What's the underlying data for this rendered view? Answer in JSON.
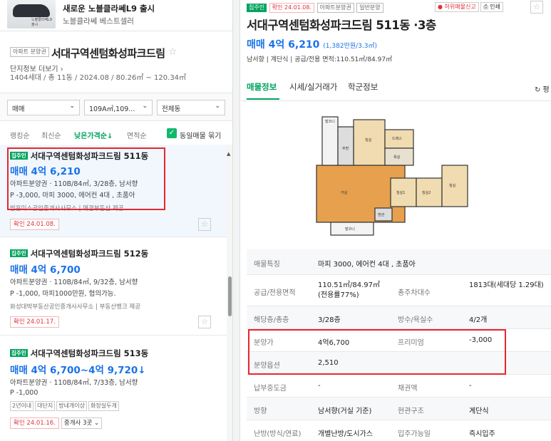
{
  "ad": {
    "title": "새로운 노블클라쎄L9 출시",
    "subtitle": "노블클라쎄 베스트셀러",
    "thumb_caption": "노블클라쎄L9 출시"
  },
  "complex": {
    "tag": "아파트 분양권",
    "name": "서대구역센텀화성파크드림",
    "more": "단지정보 더보기",
    "info": "1404세대 / 총 11동 / 2024.08 / 80.26㎡ ~ 120.34㎡"
  },
  "filters": {
    "trade": "매매",
    "area": "109A㎡,109...",
    "dong": "전체동"
  },
  "sort": {
    "options": [
      "랭킹순",
      "최신순",
      "낮은가격순↓",
      "면적순"
    ],
    "same_listing": "동일매물 묶기"
  },
  "listings": [
    {
      "badge": "집주인",
      "name": "서대구역센텀화성파크드림 511동",
      "price": "매매 4억 6,210",
      "line1": "아파트분양권 · 110B/84㎡, 3/28층, 남서향",
      "line2": "P -3,000, 마피 3000, 에어컨 4대 , 초품아",
      "agent": "방용미소공인중개사사무소 | 매경부동산 제공",
      "confirm": "확인 24.01.08."
    },
    {
      "badge": "집주인",
      "name": "서대구역센텀화성파크드림 512동",
      "price": "매매 4억 6,700",
      "line1": "아파트분양권 · 110B/84㎡, 9/32층, 남서향",
      "line2": "P -1,000, 마피1000만원, 협의가능.",
      "agent": "화성대박부동산공인중개사사무소 | 부동산뱅크 제공",
      "confirm": "확인 24.01.17."
    },
    {
      "badge": "집주인",
      "name": "서대구역센텀화성파크드림 513동",
      "price": "매매 4억 6,700~4억 9,720",
      "price_arrow": "↓",
      "line1": "아파트분양권 · 110B/84㎡, 7/33층, 남서향",
      "line2": "P -1,000",
      "tags": [
        "2년이내",
        "대단지",
        "방네개이상",
        "화장실두개"
      ],
      "confirm": "확인 24.01.16.",
      "agency_chip": "중개사 3곳 ⌄"
    }
  ],
  "detail": {
    "badge": "집주인",
    "confirm": "확인 24.01.08.",
    "tags": [
      "아파트분양권",
      "일반분양"
    ],
    "report": "● 허위매물신고",
    "print": "⎙ 인쇄",
    "title": "서대구역센텀화성파크드림 511동 ·3층",
    "price": "매매 4억 6,210",
    "price_unit": "(1,382만원/3.3㎡)",
    "spec": "남서향  |  계단식  |  공급/전용 면적:110.51㎡/84.97㎡",
    "tabs": [
      "매물정보",
      "시세/실거래가",
      "학군정보"
    ],
    "refresh": "↻ 평",
    "plan_labels": [
      "발코니",
      "침실",
      "드레스",
      "욕실",
      "주방",
      "거실",
      "현관",
      "침실1",
      "침실2",
      "침실",
      "발코니"
    ],
    "table": [
      {
        "k": "매물특징",
        "v": "마피 3000, 에어컨 4대 , 초품아"
      },
      {
        "k": "공급/전용면적",
        "v": "110.51㎡/84.97㎡(전용률77%)",
        "k2": "총주차대수",
        "v2": "1813대(세대당 1.29대)"
      },
      {
        "k": "해당층/총층",
        "v": "3/28층",
        "k2": "방수/욕실수",
        "v2": "4/2개"
      },
      {
        "k": "분양가",
        "v": "4억6,700",
        "k2": "프리미엄",
        "v2": "-3,000"
      },
      {
        "k": "분양옵션",
        "v": "2,510"
      },
      {
        "k": "납부중도금",
        "v": "-",
        "k2": "채권액",
        "v2": "-"
      },
      {
        "k": "방향",
        "v": "남서향(거실 기준)",
        "k2": "현관구조",
        "v2": "계단식"
      },
      {
        "k": "난방(방식/연료)",
        "v": "개별난방/도시가스",
        "k2": "입주가능일",
        "v2": "즉시입주"
      }
    ]
  }
}
